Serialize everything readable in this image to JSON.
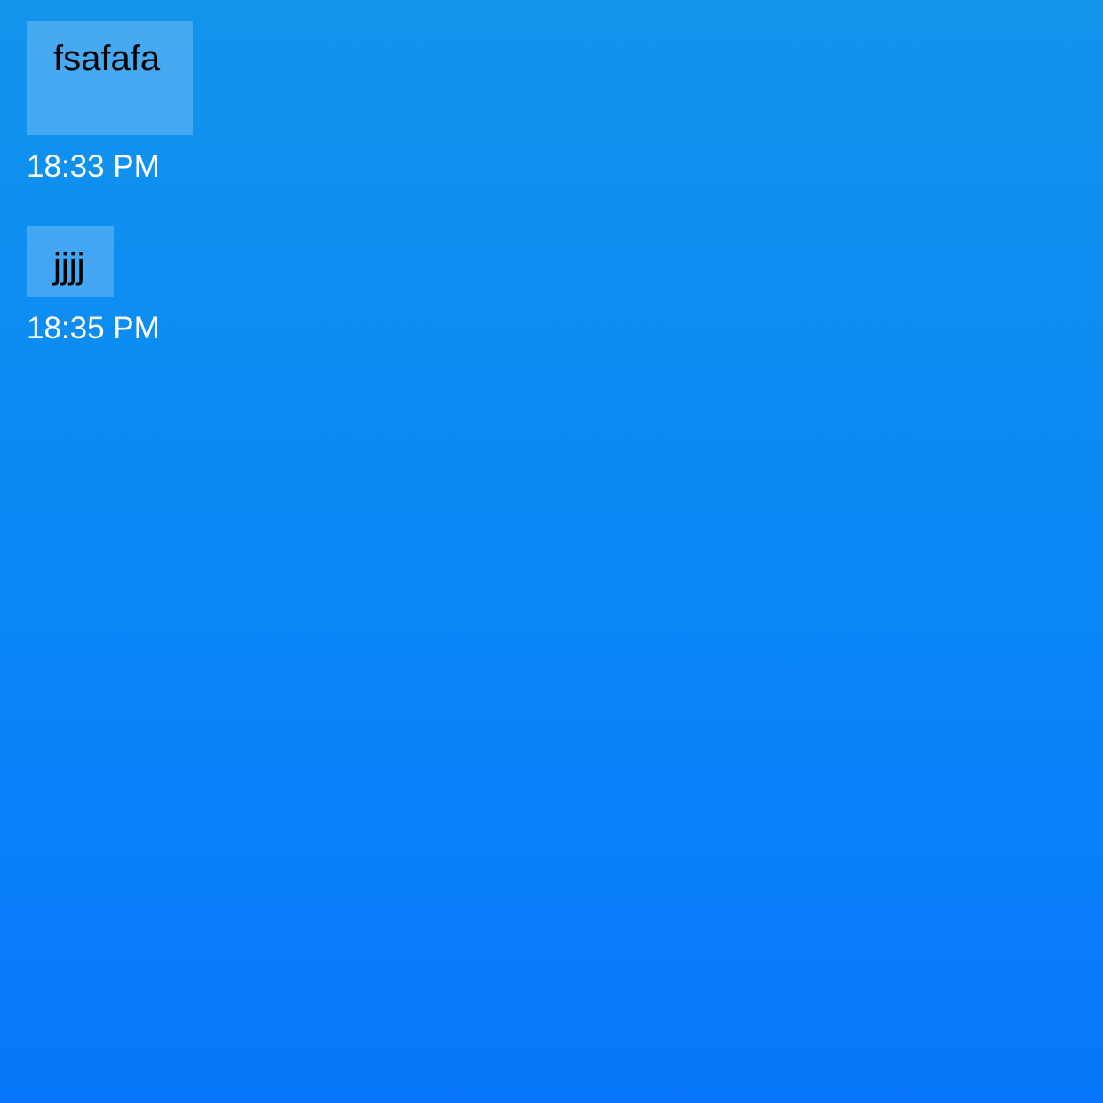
{
  "messages": [
    {
      "text": "fsafafa",
      "time": "18:33 PM"
    },
    {
      "text": "jjjj",
      "time": "18:35 PM"
    }
  ],
  "colors": {
    "background_top": "#1294ec",
    "background_bottom": "#0877fb",
    "bubble": "rgba(255,255,255,0.22)",
    "message_text": "#000000",
    "timestamp_text": "#ffffff"
  }
}
